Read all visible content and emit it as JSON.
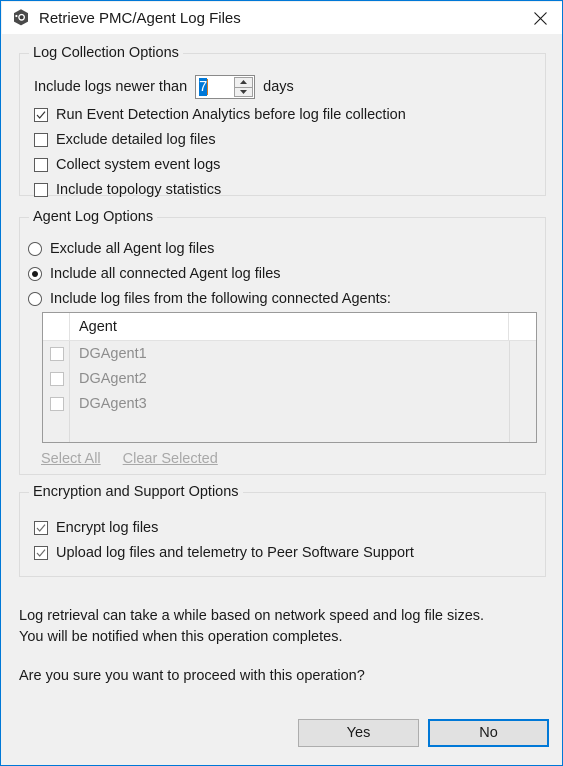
{
  "window": {
    "title": "Retrieve PMC/Agent Log Files",
    "icon": "app-hexagon-icon",
    "close_icon": "close-icon",
    "accent_color": "#0078d7",
    "background_color": "#f0f0f0",
    "titlebar_color": "#ffffff"
  },
  "log_collection": {
    "group_title": "Log Collection Options",
    "days_label_prefix": "Include logs newer than",
    "days_value": "7",
    "days_label_suffix": "days",
    "spinner_up_icon": "chevron-up-icon",
    "spinner_down_icon": "chevron-down-icon",
    "checkboxes": [
      {
        "label": "Run Event Detection Analytics before log file collection",
        "checked": true
      },
      {
        "label": "Exclude detailed log files",
        "checked": false
      },
      {
        "label": "Collect system event logs",
        "checked": false
      },
      {
        "label": "Include topology statistics",
        "checked": false
      }
    ]
  },
  "agent_log": {
    "group_title": "Agent Log Options",
    "radios": [
      {
        "label": "Exclude all Agent log files",
        "selected": false
      },
      {
        "label": "Include all connected Agent log files",
        "selected": true
      },
      {
        "label": "Include log files from the following connected Agents:",
        "selected": false
      }
    ],
    "table": {
      "columns": [
        "Agent"
      ],
      "rows": [
        {
          "name": "DGAgent1",
          "checked": false
        },
        {
          "name": "DGAgent2",
          "checked": false
        },
        {
          "name": "DGAgent3",
          "checked": false
        }
      ]
    },
    "links": [
      {
        "label": "Select All",
        "enabled": false
      },
      {
        "label": "Clear Selected",
        "enabled": false
      }
    ]
  },
  "encryption": {
    "group_title": "Encryption and Support Options",
    "checkboxes": [
      {
        "label": "Encrypt log files",
        "checked": true
      },
      {
        "label": "Upload log files and telemetry to Peer Software Support",
        "checked": true
      }
    ]
  },
  "message": {
    "line1": "Log retrieval can take a while based on network speed and log file sizes.",
    "line2": "You will be notified when this operation completes.",
    "line3": "Are you sure you want to proceed with this operation?"
  },
  "buttons": {
    "yes": "Yes",
    "no": "No",
    "focused": "No"
  }
}
